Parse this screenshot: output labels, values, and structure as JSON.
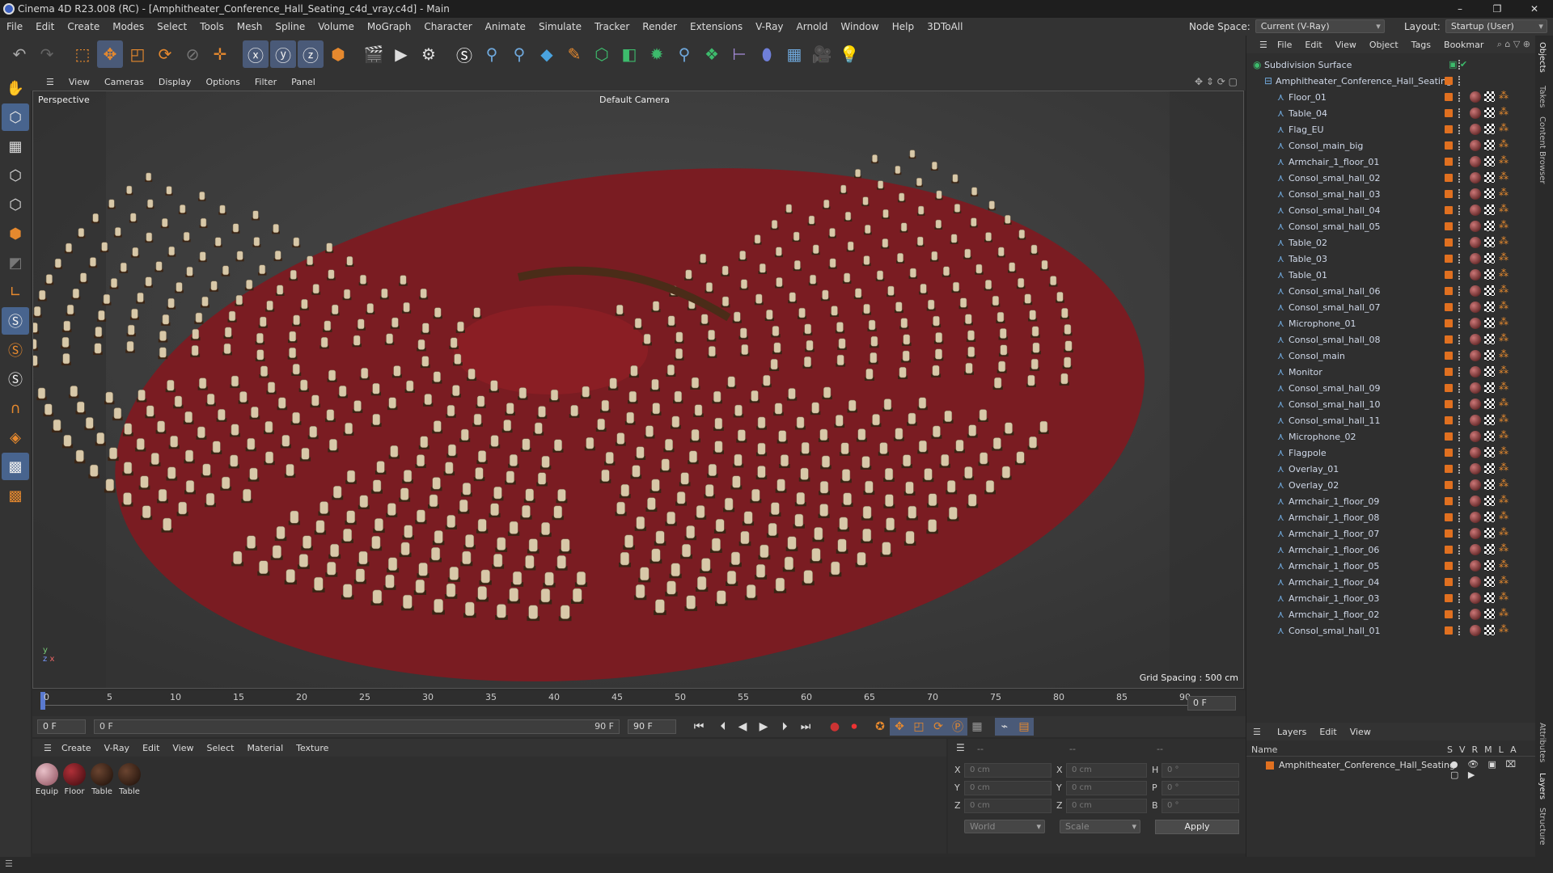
{
  "window": {
    "title": "Cinema 4D R23.008 (RC) - [Amphitheater_Conference_Hall_Seating_c4d_vray.c4d] - Main"
  },
  "menu": [
    "File",
    "Edit",
    "Create",
    "Modes",
    "Select",
    "Tools",
    "Mesh",
    "Spline",
    "Volume",
    "MoGraph",
    "Character",
    "Animate",
    "Simulate",
    "Tracker",
    "Render",
    "Extensions",
    "V-Ray",
    "Arnold",
    "Window",
    "Help",
    "3DToAll"
  ],
  "nodespace": {
    "label": "Node Space:",
    "value": "Current (V-Ray)"
  },
  "layout": {
    "label": "Layout:",
    "value": "Startup (User)"
  },
  "viewport_menu": [
    "View",
    "Cameras",
    "Display",
    "Options",
    "Filter",
    "Panel"
  ],
  "viewport": {
    "name": "Perspective",
    "camera": "Default Camera",
    "grid": "Grid Spacing : 500 cm"
  },
  "timeline": {
    "ticks": [
      "0",
      "5",
      "10",
      "15",
      "20",
      "25",
      "30",
      "35",
      "40",
      "45",
      "50",
      "55",
      "60",
      "65",
      "70",
      "75",
      "80",
      "85",
      "90"
    ],
    "current_frame": "0 F"
  },
  "transport": {
    "start": "0 F",
    "range_start": "0 F",
    "range_end": "90 F",
    "end": "90 F"
  },
  "material_menu": [
    "Create",
    "V-Ray",
    "Edit",
    "View",
    "Select",
    "Material",
    "Texture"
  ],
  "materials": [
    {
      "name": "Equip",
      "color": "#b0808a"
    },
    {
      "name": "Floor",
      "color": "#6a1a1e"
    },
    {
      "name": "Table",
      "color": "#3a2418"
    },
    {
      "name": "Table",
      "color": "#3a2418"
    }
  ],
  "attributes": {
    "rows": [
      {
        "a": "X",
        "av": "0 cm",
        "b": "X",
        "bv": "0 cm",
        "c": "H",
        "cv": "0 °"
      },
      {
        "a": "Y",
        "av": "0 cm",
        "b": "Y",
        "bv": "0 cm",
        "c": "P",
        "cv": "0 °"
      },
      {
        "a": "Z",
        "av": "0 cm",
        "b": "Z",
        "bv": "0 cm",
        "c": "B",
        "cv": "0 °"
      }
    ],
    "coord": "World",
    "mode": "Scale",
    "apply": "Apply",
    "dash1": "--",
    "dash2": "--",
    "dash3": "--"
  },
  "objects_menu": [
    "File",
    "Edit",
    "View",
    "Object",
    "Tags",
    "Bookmar"
  ],
  "objects": {
    "root": "Subdivision Surface",
    "group": "Amphitheater_Conference_Hall_Seating",
    "items": [
      "Floor_01",
      "Table_04",
      "Flag_EU",
      "Consol_main_big",
      "Armchair_1_floor_01",
      "Consol_smal_hall_02",
      "Consol_smal_hall_03",
      "Consol_smal_hall_04",
      "Consol_smal_hall_05",
      "Table_02",
      "Table_03",
      "Table_01",
      "Consol_smal_hall_06",
      "Consol_smal_hall_07",
      "Microphone_01",
      "Consol_smal_hall_08",
      "Consol_main",
      "Monitor",
      "Consol_smal_hall_09",
      "Consol_smal_hall_10",
      "Consol_smal_hall_11",
      "Microphone_02",
      "Flagpole",
      "Overlay_01",
      "Overlay_02",
      "Armchair_1_floor_09",
      "Armchair_1_floor_08",
      "Armchair_1_floor_07",
      "Armchair_1_floor_06",
      "Armchair_1_floor_05",
      "Armchair_1_floor_04",
      "Armchair_1_floor_03",
      "Armchair_1_floor_02",
      "Consol_smal_hall_01"
    ]
  },
  "layers_menu": [
    "Layers",
    "Edit",
    "View"
  ],
  "layers": {
    "header": "Name",
    "cols": [
      "S",
      "V",
      "R",
      "M",
      "L",
      "A"
    ],
    "item": "Amphitheater_Conference_Hall_Seating"
  },
  "side_tabs": [
    "Objects",
    "Takes",
    "Content Browser",
    "Attributes",
    "Layers",
    "Structure"
  ],
  "colors": {
    "accent": "#4a5a78",
    "tag": "#e07020",
    "floor": "#7a1c22",
    "seat": "#d8c8a8"
  }
}
